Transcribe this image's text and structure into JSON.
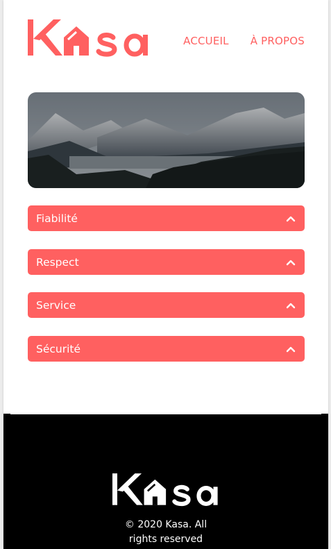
{
  "brand": {
    "name": "Kasa",
    "accent_color": "#ff6060",
    "logo_icon": "house-icon"
  },
  "nav": {
    "items": [
      {
        "label": "ACCUEIL"
      },
      {
        "label": "À PROPOS"
      }
    ]
  },
  "banner": {
    "image": "mountain-landscape"
  },
  "accordions": [
    {
      "label": "Fiabilité",
      "icon": "chevron-up-icon",
      "expanded": false
    },
    {
      "label": "Respect",
      "icon": "chevron-up-icon",
      "expanded": false
    },
    {
      "label": "Service",
      "icon": "chevron-up-icon",
      "expanded": false
    },
    {
      "label": "Sécurité",
      "icon": "chevron-up-icon",
      "expanded": false
    }
  ],
  "footer": {
    "background": "#000000",
    "copyright_line1": "© 2020 Kasa. All",
    "copyright_line2": "rights reserved"
  }
}
